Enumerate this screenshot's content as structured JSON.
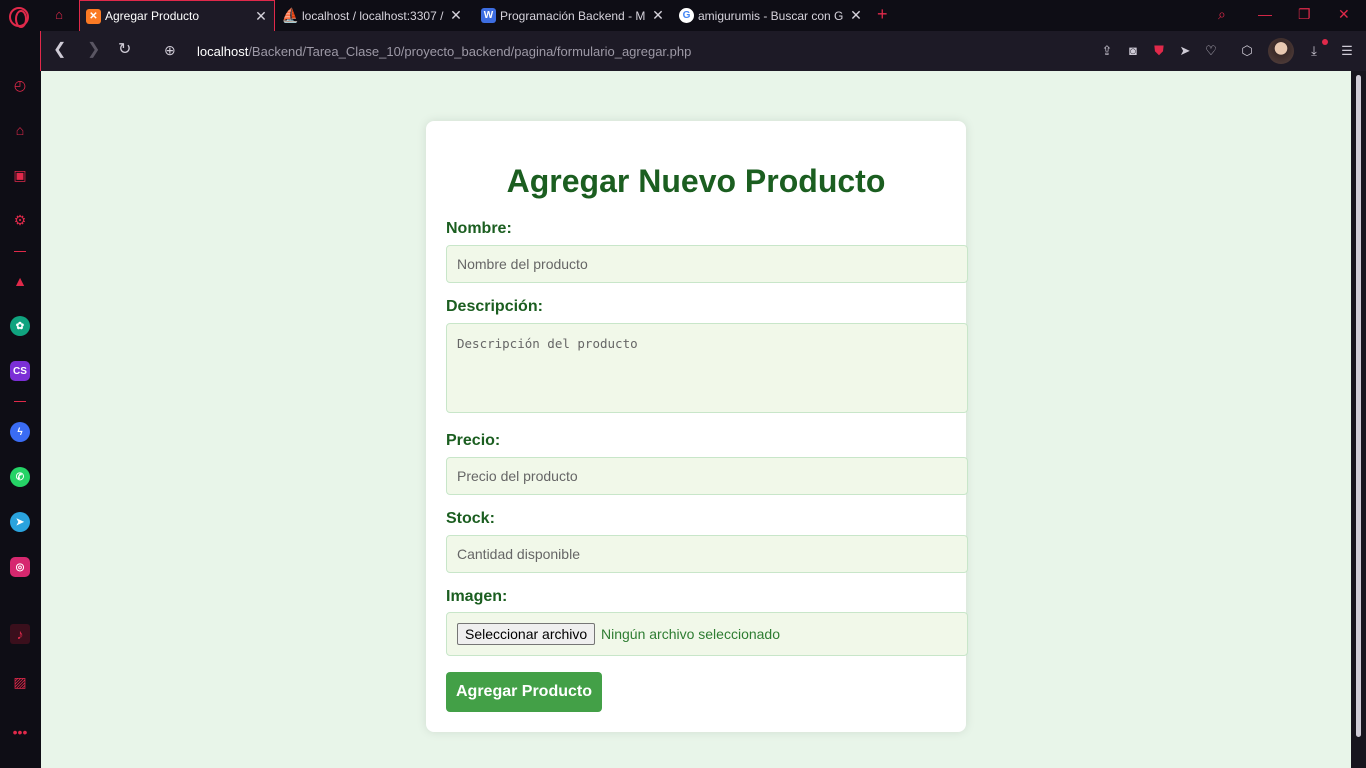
{
  "browser": {
    "tabs": [
      {
        "title": "Agregar Producto",
        "icon": "xampp-icon",
        "color": "#fb7a24",
        "active": true
      },
      {
        "title": "localhost / localhost:3307 /",
        "icon": "phpmyadmin-icon",
        "color": "#f89c0e",
        "active": false
      },
      {
        "title": "Programación Backend - M",
        "icon": "moodle-icon",
        "color": "#3d6de1",
        "active": false
      },
      {
        "title": "amigurumis - Buscar con G",
        "icon": "google-icon",
        "color": "#ffffff",
        "active": false
      }
    ],
    "url_host": "localhost",
    "url_path": "/Backend/Tarea_Clase_10/proyecto_backend/pagina/formulario_agregar.php",
    "accent_color": "#e0294a"
  },
  "sidebar": {
    "items": [
      {
        "name": "speed-dial-icon"
      },
      {
        "name": "bag-icon"
      },
      {
        "name": "twitch-icon"
      },
      {
        "name": "gx-control-icon"
      },
      {
        "name": "aria-icon"
      },
      {
        "name": "chatgpt-icon"
      },
      {
        "name": "cs-icon"
      },
      {
        "name": "messenger-icon"
      },
      {
        "name": "whatsapp-icon"
      },
      {
        "name": "telegram-icon"
      },
      {
        "name": "instagram-icon"
      },
      {
        "name": "music-player-icon"
      },
      {
        "name": "gallery-icon"
      },
      {
        "name": "more-icon"
      }
    ]
  },
  "form": {
    "title": "Agregar Nuevo Producto",
    "nombre_label": "Nombre:",
    "nombre_placeholder": "Nombre del producto",
    "descripcion_label": "Descripción:",
    "descripcion_placeholder": "Descripción del producto",
    "precio_label": "Precio:",
    "precio_placeholder": "Precio del producto",
    "stock_label": "Stock:",
    "stock_placeholder": "Cantidad disponible",
    "imagen_label": "Imagen:",
    "file_button": "Seleccionar archivo",
    "file_status": "Ningún archivo seleccionado",
    "submit_label": "Agregar Producto",
    "colors": {
      "heading": "#1b5e20",
      "button": "#43a047",
      "page_bg": "#e8f5e9",
      "input_bg": "#f1f8e9"
    }
  }
}
